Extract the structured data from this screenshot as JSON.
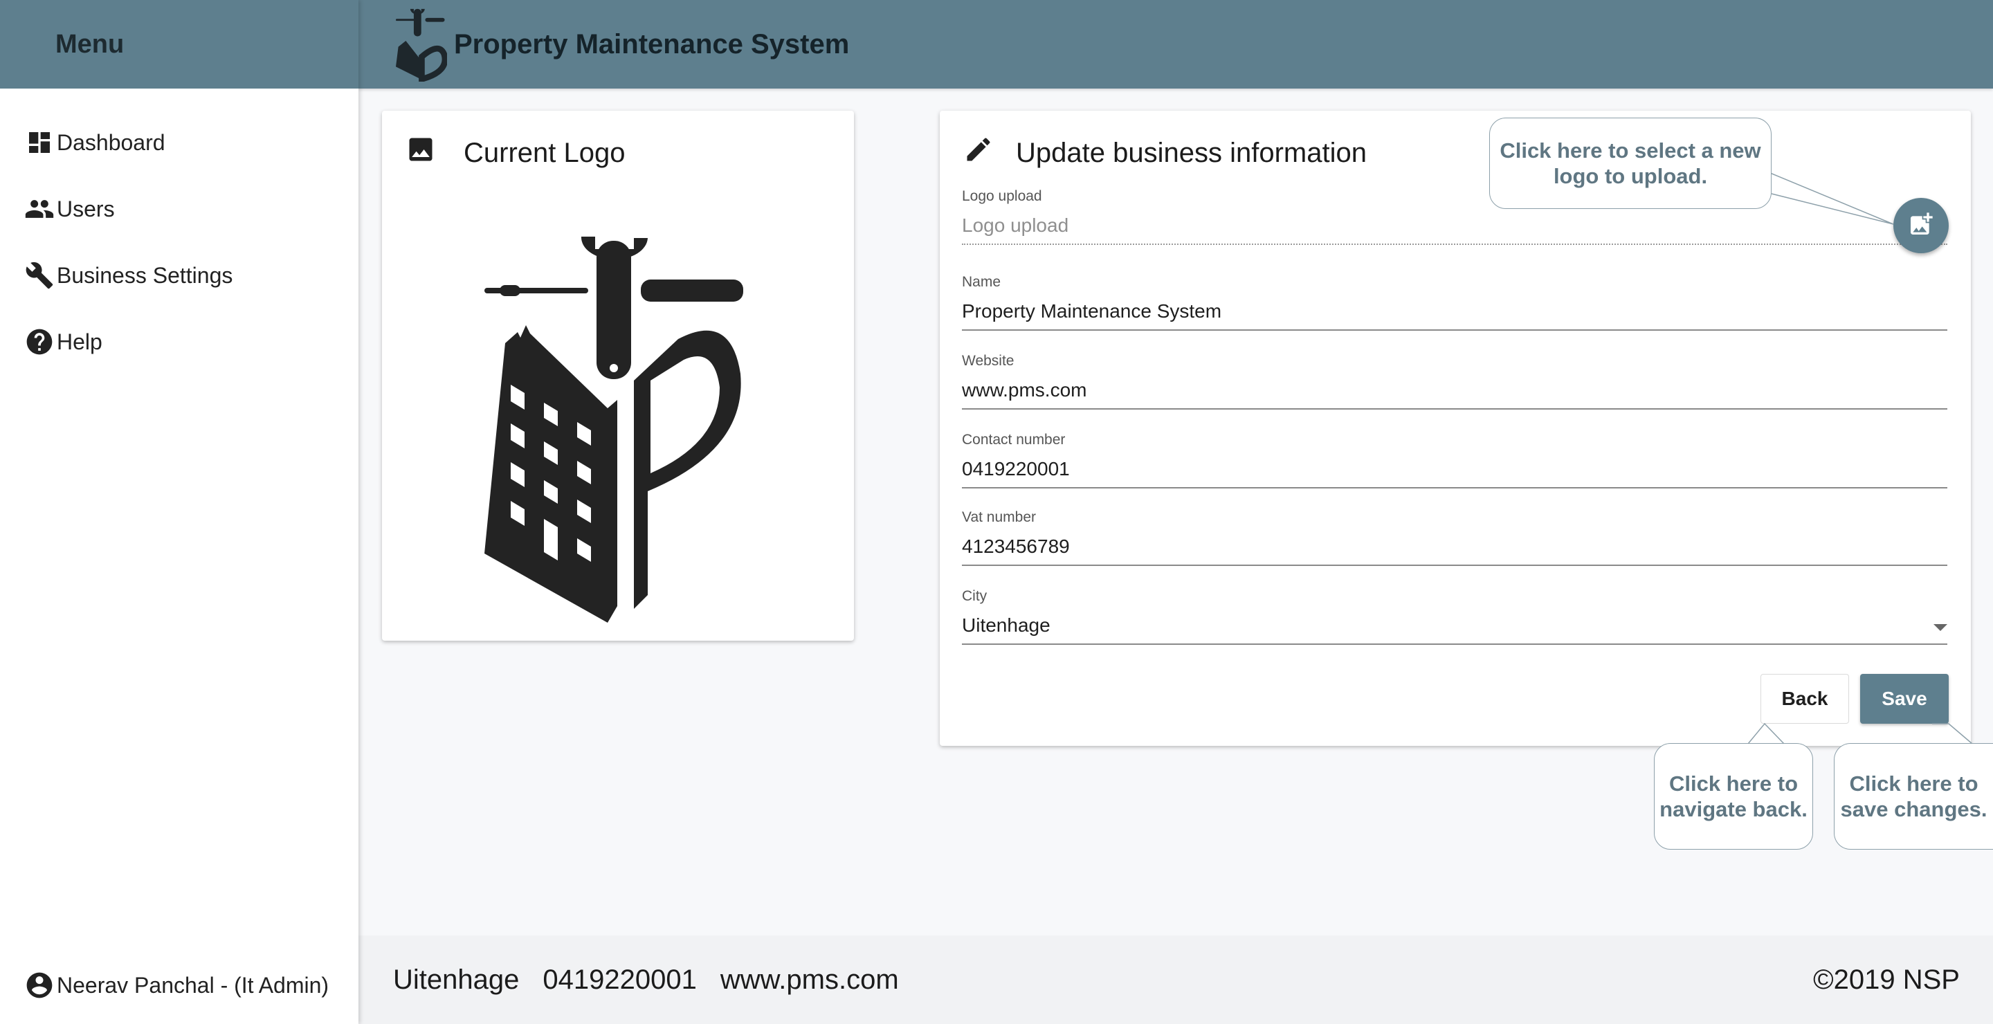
{
  "sidebar": {
    "menu_title": "Menu",
    "items": [
      {
        "label": "Dashboard",
        "icon": "dashboard-icon"
      },
      {
        "label": "Users",
        "icon": "users-icon"
      },
      {
        "label": "Business Settings",
        "icon": "wrench-icon"
      },
      {
        "label": "Help",
        "icon": "help-icon"
      }
    ],
    "user": {
      "label": "Neerav Panchal - (It Admin)",
      "icon": "account-circle-icon"
    }
  },
  "topbar": {
    "title": "Property Maintenance System",
    "logo": "building-tools-logo"
  },
  "logo_card": {
    "title": "Current Logo",
    "icon": "image-icon"
  },
  "info_card": {
    "title": "Update business information",
    "icon": "pencil-icon",
    "fields": {
      "logo": {
        "label": "Logo upload",
        "placeholder": "Logo upload"
      },
      "name": {
        "label": "Name",
        "value": "Property Maintenance System"
      },
      "website": {
        "label": "Website",
        "value": "www.pms.com"
      },
      "contact": {
        "label": "Contact number",
        "value": "0419220001"
      },
      "vat": {
        "label": "Vat number",
        "value": "4123456789"
      },
      "city": {
        "label": "City",
        "value": "Uitenhage"
      }
    },
    "buttons": {
      "back": "Back",
      "save": "Save"
    },
    "upload_button_icon": "add-photo-icon"
  },
  "callouts": {
    "upload": "Click here to select a new logo to upload.",
    "back": "Click here to navigate back.",
    "save": "Click here to save changes."
  },
  "footer": {
    "city": "Uitenhage",
    "phone": "0419220001",
    "website": "www.pms.com",
    "copyright": "©2019 NSP"
  },
  "colors": {
    "primary": "#5e7f8e",
    "callout_text": "#5f7682"
  }
}
